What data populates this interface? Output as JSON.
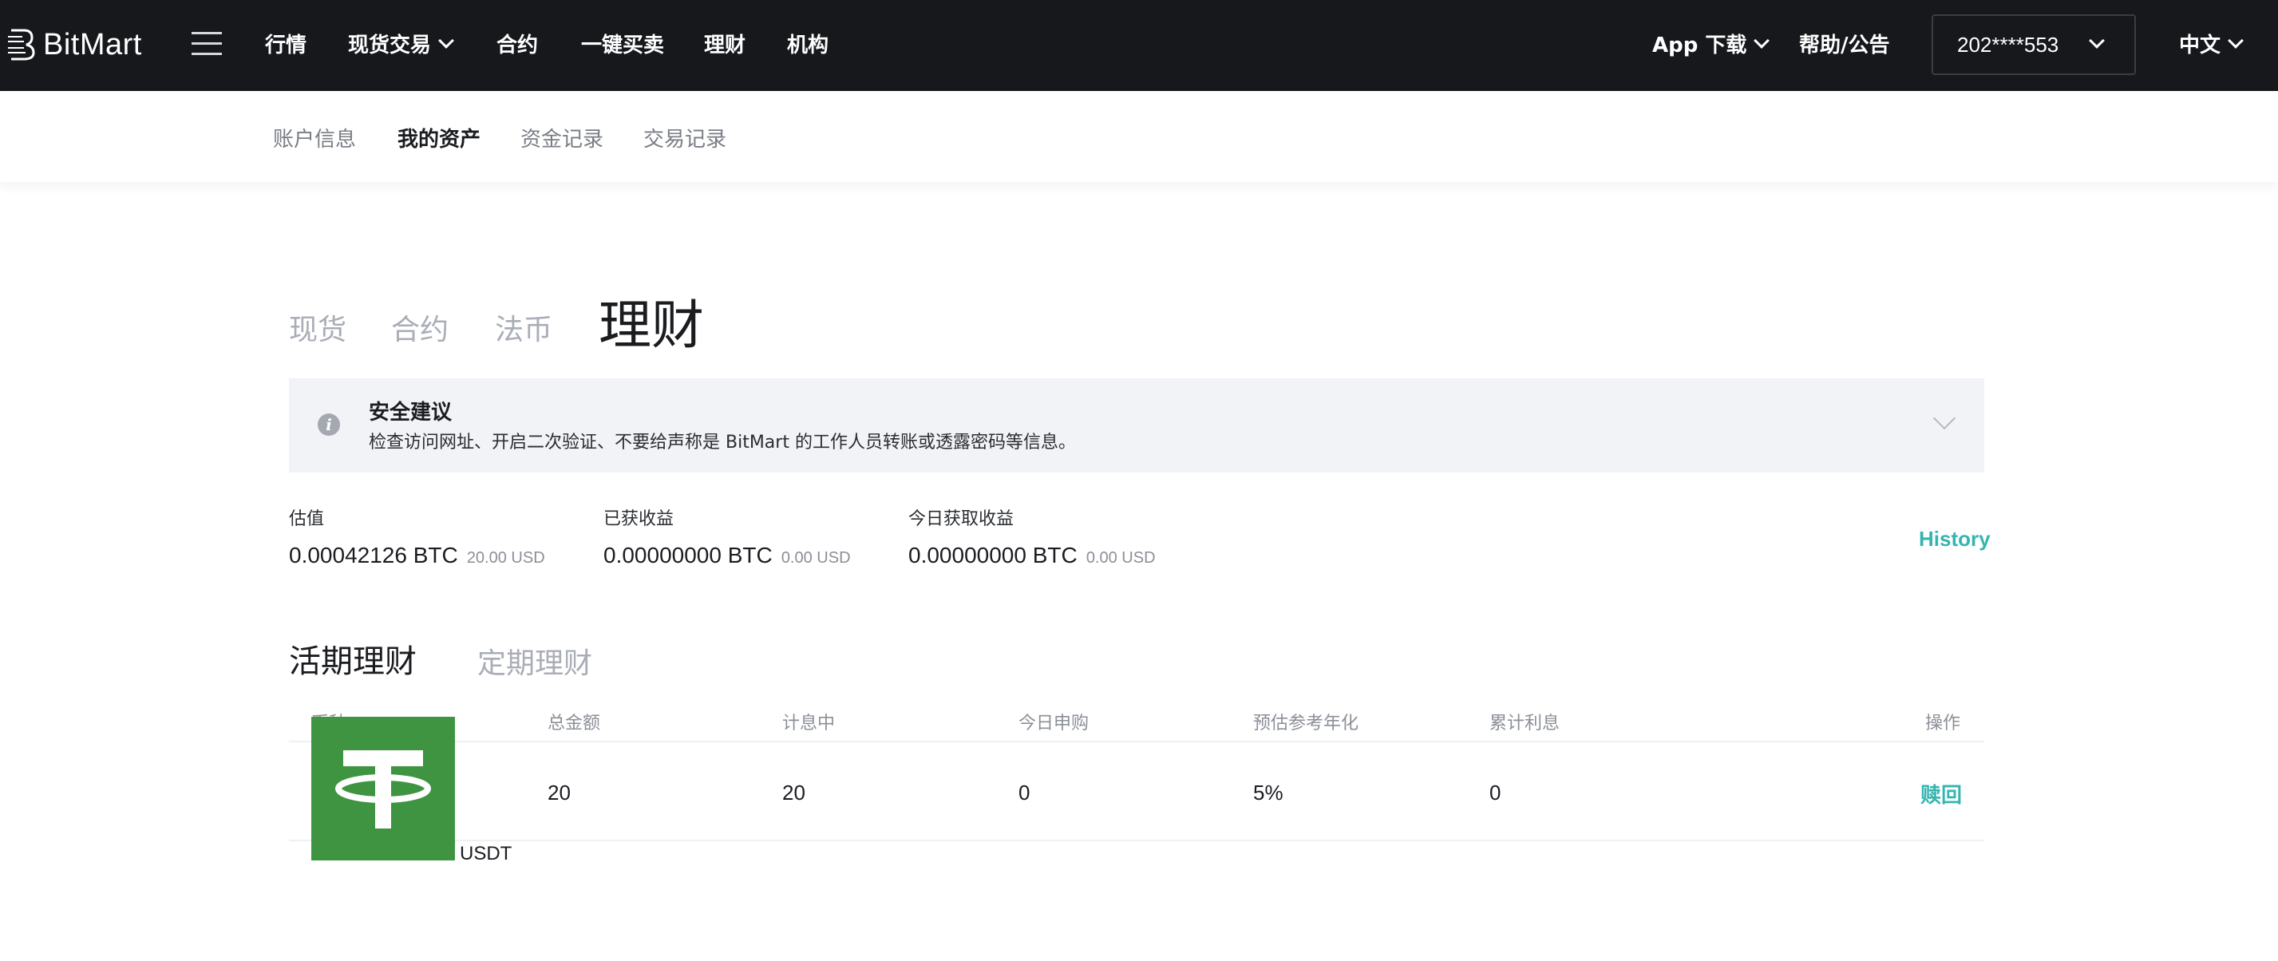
{
  "brand": {
    "name": "BitMart"
  },
  "nav": {
    "items": [
      "行情",
      "现货交易",
      "合约",
      "一键买卖",
      "理财",
      "机构"
    ],
    "app_download": "App 下载",
    "help": "帮助/公告",
    "account": "202****553",
    "language": "中文"
  },
  "subnav": {
    "items": [
      "账户信息",
      "我的资产",
      "资金记录",
      "交易记录"
    ],
    "active": "我的资产"
  },
  "asset_tabs": {
    "items": [
      "现货",
      "合约",
      "法币",
      "理财"
    ],
    "active": "理财"
  },
  "banner": {
    "title": "安全建议",
    "text": "检查访问网址、开启二次验证、不要给声称是 BitMart 的工作人员转账或透露密码等信息。"
  },
  "stats": [
    {
      "label": "估值",
      "value": "0.00042126 BTC",
      "sub": "20.00 USD"
    },
    {
      "label": "已获收益",
      "value": "0.00000000 BTC",
      "sub": "0.00 USD"
    },
    {
      "label": "今日获取收益",
      "value": "0.00000000 BTC",
      "sub": "0.00 USD"
    }
  ],
  "history_label": "History",
  "earn_tabs": {
    "items": [
      "活期理财",
      "定期理财"
    ],
    "active": "活期理财"
  },
  "table": {
    "headers": [
      "币种",
      "总金额",
      "计息中",
      "今日申购",
      "预估参考年化",
      "累计利息",
      "操作"
    ],
    "rows": [
      {
        "coin": "USDT",
        "total": "20",
        "interest_bearing": "20",
        "today_subscribe": "0",
        "apy": "5%",
        "accumulated": "0",
        "action": "赎回"
      }
    ]
  },
  "colors": {
    "topbar_bg": "#16181c",
    "accent": "#35b5b2",
    "banner_bg": "#f2f3f6",
    "usdt_green": "#3f9441"
  },
  "icons": {
    "menu": "hamburger-icon",
    "info": "info-icon",
    "expand": "chevron-down-icon",
    "logo": "bitmart-logo-icon"
  }
}
